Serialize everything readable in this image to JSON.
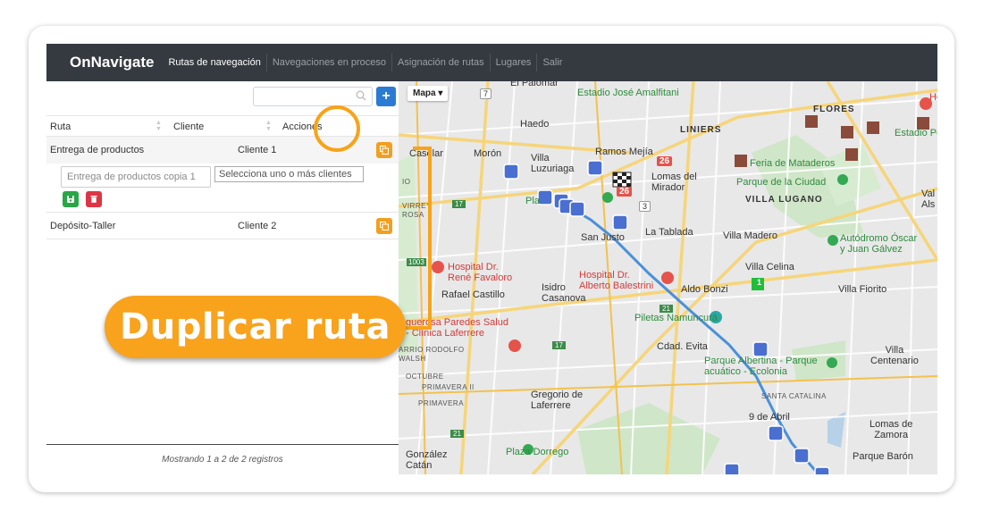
{
  "navbar": {
    "brand": "OnNavigate",
    "items": [
      "Rutas de navegación",
      "Navegaciones en proceso",
      "Asignación de rutas",
      "Lugares",
      "Salir"
    ]
  },
  "table": {
    "search_placeholder": "",
    "add_label": "+",
    "headers": [
      "Ruta",
      "Cliente",
      "Acciones"
    ],
    "rows": [
      {
        "ruta": "Entrega de productos",
        "cliente": "Cliente 1"
      },
      {
        "ruta": "Depósito-Taller",
        "cliente": "Cliente 2"
      }
    ],
    "edit": {
      "name_placeholder": "Entrega de productos copia 1",
      "clients_placeholder": "Selecciona uno o más clientes"
    },
    "footer": "Mostrando 1 a 2 de 2 registros"
  },
  "map": {
    "type_label": "Mapa",
    "labels": {
      "el_palomar": "El Palomar",
      "estadio": "Estadio José Amalfitani",
      "haedo": "Haedo",
      "liniers": "LINIERS",
      "flores": "FLORES",
      "estadio_ped": "Estadio Ped",
      "hotel": "Hot",
      "casselar": "Caselar",
      "moron": "Morón",
      "villa_luzuriaga": "Villa\nLuzuriaga",
      "ramos_mejia": "Ramos Mejía",
      "lomas_mirador": "Lomas del\nMirador",
      "feria": "Feria de Mataderos",
      "parque_ciudad": "Parque de la Ciudad",
      "villa_lugano": "VILLA LUGANO",
      "val": "Val\nAls",
      "plaza": "Pla",
      "san_justo": "San Justo",
      "la_tablada": "La Tablada",
      "villa_madero": "Villa Madero",
      "autodromo": "Autódromo Óscar\ny Juan Gálvez",
      "hospital_favaloro": "Hospital Dr.\nRené Favaloro",
      "villa_celina": "Villa Celina",
      "hospital_balestrini": "Hospital Dr.\nAlberto Balestrini",
      "aldo_bonzi": "Aldo Bonzi",
      "rafael_castillo": "Rafael Castillo",
      "isidro": "Isidro\nCasanova",
      "villa_fiorito": "Villa Fiorito",
      "piletas": "Piletas Namuncurá",
      "laguerosa": "guerosa Paredes Salud\n- Clínica Laferrere",
      "cdad_evita": "Cdad. Evita",
      "parque_albertina": "Parque Albertina - Parque\nacuático - Ecolonia",
      "villa_centenario": "Villa\nCentenario",
      "gregorio": "Gregorio de\nLaferrere",
      "santa_catalina": "SANTA CATALINA",
      "nueve_abril": "9 de Abril",
      "lomas_zamora": "Lomas de\nZamora",
      "plaza_dorrego": "Plaza Dorrego",
      "gonzalez_catan": "González\nCatán",
      "parque_baron": "Parque Barón",
      "barrio_rodolfo": "ARRIO RODOLFO\nWALSH",
      "octubre": "OCTUBRE",
      "primavera2": "PRIMAVERA II",
      "primavera": "PRIMAVERA",
      "virrey": "VIRREY\nROSA",
      "isidro_t": "IO"
    },
    "badges": {
      "r26a": "26",
      "r26b": "26",
      "r7": "7",
      "r17a": "17",
      "r3": "3",
      "r1003": "1003",
      "r21a": "21",
      "r17b": "17",
      "r21b": "21",
      "start": "1"
    }
  },
  "callout": {
    "text": "Duplicar ruta"
  },
  "colors": {
    "accent": "#f7a31a",
    "primary": "#2a7bd3",
    "route": "#4a90d9",
    "save": "#28a745",
    "delete": "#dc3545"
  }
}
